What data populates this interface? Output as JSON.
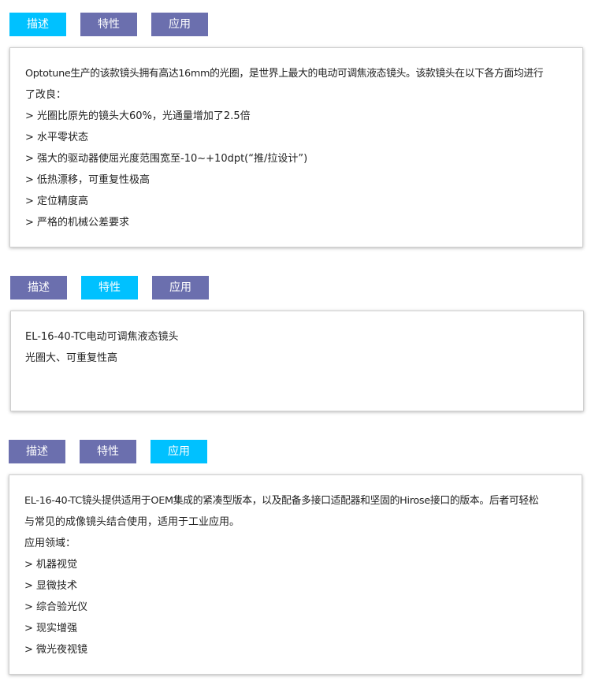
{
  "colors": {
    "active_tab": "#00c1ff",
    "inactive_tab": "#6b6fae"
  },
  "sections": [
    {
      "tabs": [
        {
          "label": "描述",
          "active": true
        },
        {
          "label": "特性",
          "active": false
        },
        {
          "label": "应用",
          "active": false
        }
      ],
      "lines": [
        "Optotune生产的该款镜头拥有高达16mm的光圈，是世界上最大的电动可调焦液态镜头。该款镜头在以下各方面均进行",
        "了改良：",
        "> 光圈比原先的镜头大60%，光通量增加了2.5倍",
        "> 水平零状态",
        "> 强大的驱动器使屈光度范围宽至-10~+10dpt(“推/拉设计”)",
        "> 低热漂移，可重复性极高",
        "> 定位精度高",
        "> 严格的机械公差要求"
      ]
    },
    {
      "tabs": [
        {
          "label": "描述",
          "active": false
        },
        {
          "label": "特性",
          "active": true
        },
        {
          "label": "应用",
          "active": false
        }
      ],
      "lines": [
        "EL-16-40-TC电动可调焦液态镜头",
        "光圈大、可重复性高"
      ]
    },
    {
      "tabs": [
        {
          "label": "描述",
          "active": false
        },
        {
          "label": "特性",
          "active": false
        },
        {
          "label": "应用",
          "active": true
        }
      ],
      "lines": [
        "EL-16-40-TC镜头提供适用于OEM集成的紧凑型版本，以及配备多接口适配器和坚固的Hirose接口的版本。后者可轻松",
        "与常见的成像镜头结合使用，适用于工业应用。",
        "应用领域：",
        "> 机器视觉",
        "> 显微技术",
        "> 综合验光仪",
        "> 现实增强",
        "> 微光夜视镜"
      ]
    }
  ]
}
